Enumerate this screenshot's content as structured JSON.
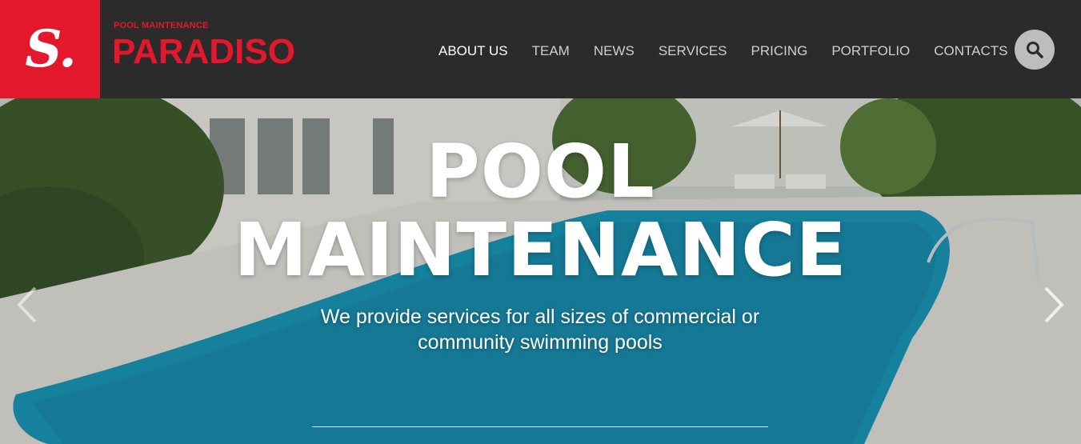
{
  "brand": {
    "logo_letter": "S.",
    "subtitle": "POOL MAINTENANCE",
    "name": "PARADISO"
  },
  "nav": {
    "items": [
      "ABOUT US",
      "TEAM",
      "NEWS",
      "SERVICES",
      "PRICING",
      "PORTFOLIO",
      "CONTACTS"
    ],
    "active": "ABOUT US"
  },
  "search": {
    "icon": "search-icon"
  },
  "hero": {
    "title_line1": "POOL",
    "title_line2": "MAINTENANCE",
    "subtitle": "We provide services for all sizes of commercial or community swimming pools",
    "prev_icon": "chevron-left-icon",
    "next_icon": "chevron-right-icon"
  },
  "colors": {
    "brand_red": "#e3182d",
    "header_bg": "#2b2b2b",
    "pool_blue": "#1a93b3"
  }
}
